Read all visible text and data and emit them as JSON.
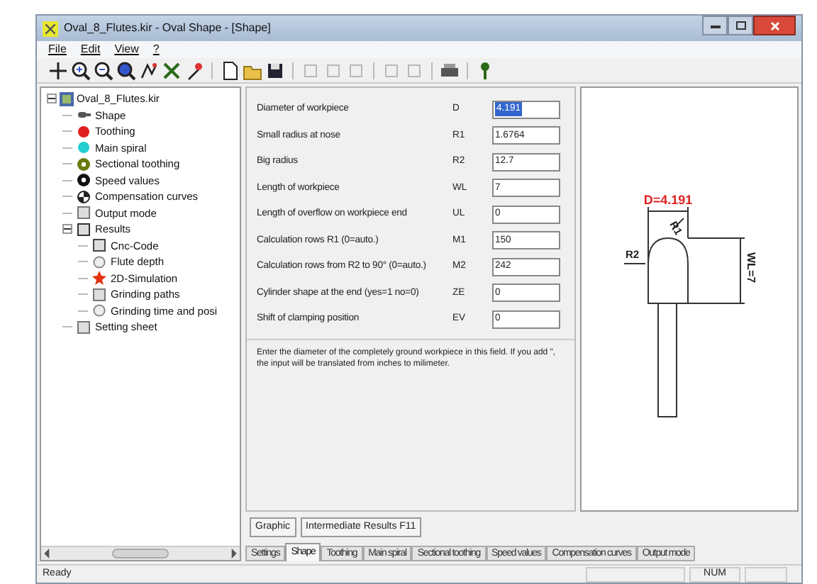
{
  "window": {
    "title": "Oval_8_Flutes.kir - Oval Shape - [Shape]"
  },
  "menu": [
    "File",
    "Edit",
    "View",
    "?"
  ],
  "tree": {
    "label": "Oval_8_Flutes.kir",
    "expanded": true,
    "children": [
      {
        "label": "Shape"
      },
      {
        "label": "Toothing"
      },
      {
        "label": "Main spiral"
      },
      {
        "label": "Sectional toothing"
      },
      {
        "label": "Speed values"
      },
      {
        "label": "Compensation curves"
      },
      {
        "label": "Output mode"
      },
      {
        "label": "Results",
        "expanded": true,
        "children": [
          {
            "label": "Cnc-Code"
          },
          {
            "label": "Flute depth"
          },
          {
            "label": "2D-Simulation"
          },
          {
            "label": "Grinding paths"
          },
          {
            "label": "Grinding time and posi"
          }
        ]
      },
      {
        "label": "Setting sheet"
      }
    ]
  },
  "form": {
    "rows": [
      {
        "label": "Diameter of workpiece",
        "symbol": "D",
        "value": "4.191",
        "highlighted": true
      },
      {
        "label": "Small radius at nose",
        "symbol": "R1",
        "value": "1.6764",
        "highlighted": false
      },
      {
        "label": "Big radius",
        "symbol": "R2",
        "value": "12.7",
        "highlighted": false
      },
      {
        "label": "Length of workpiece",
        "symbol": "WL",
        "value": "7",
        "highlighted": false
      },
      {
        "label": "Length of overflow on workpiece end",
        "symbol": "UL",
        "value": "0",
        "highlighted": false
      },
      {
        "label": "Calculation rows R1 (0=auto.)",
        "symbol": "M1",
        "value": "150",
        "highlighted": false
      },
      {
        "label": "Calculation rows from R2 to 90° (0=auto.)",
        "symbol": "M2",
        "value": "242",
        "highlighted": false
      },
      {
        "label": "Cylinder shape at the end (yes=1 no=0)",
        "symbol": "ZE",
        "value": "0",
        "highlighted": false
      },
      {
        "label": "Shift of clamping position",
        "symbol": "EV",
        "value": "0",
        "highlighted": false
      }
    ],
    "help": "Enter the diameter of the completely ground workpiece in this field. If you add \", the input will be translated from inches to milimeter."
  },
  "drawing": {
    "diameter": "D=4.191",
    "r1": "R1",
    "r2": "R2",
    "length": "WL=7"
  },
  "buttons": [
    "Graphic",
    "Intermediate Results F11"
  ],
  "tabs": [
    {
      "label": "Settings",
      "selected": false
    },
    {
      "label": "Shape",
      "selected": true
    },
    {
      "label": "Toothing",
      "selected": false
    },
    {
      "label": "Main spiral",
      "selected": false
    },
    {
      "label": "Sectional toothing",
      "selected": false
    },
    {
      "label": "Speed values",
      "selected": false
    },
    {
      "label": "Compensation curves",
      "selected": false
    },
    {
      "label": "Output mode",
      "selected": false
    }
  ],
  "status_bar": {
    "text": "Ready",
    "num": "NUM"
  }
}
